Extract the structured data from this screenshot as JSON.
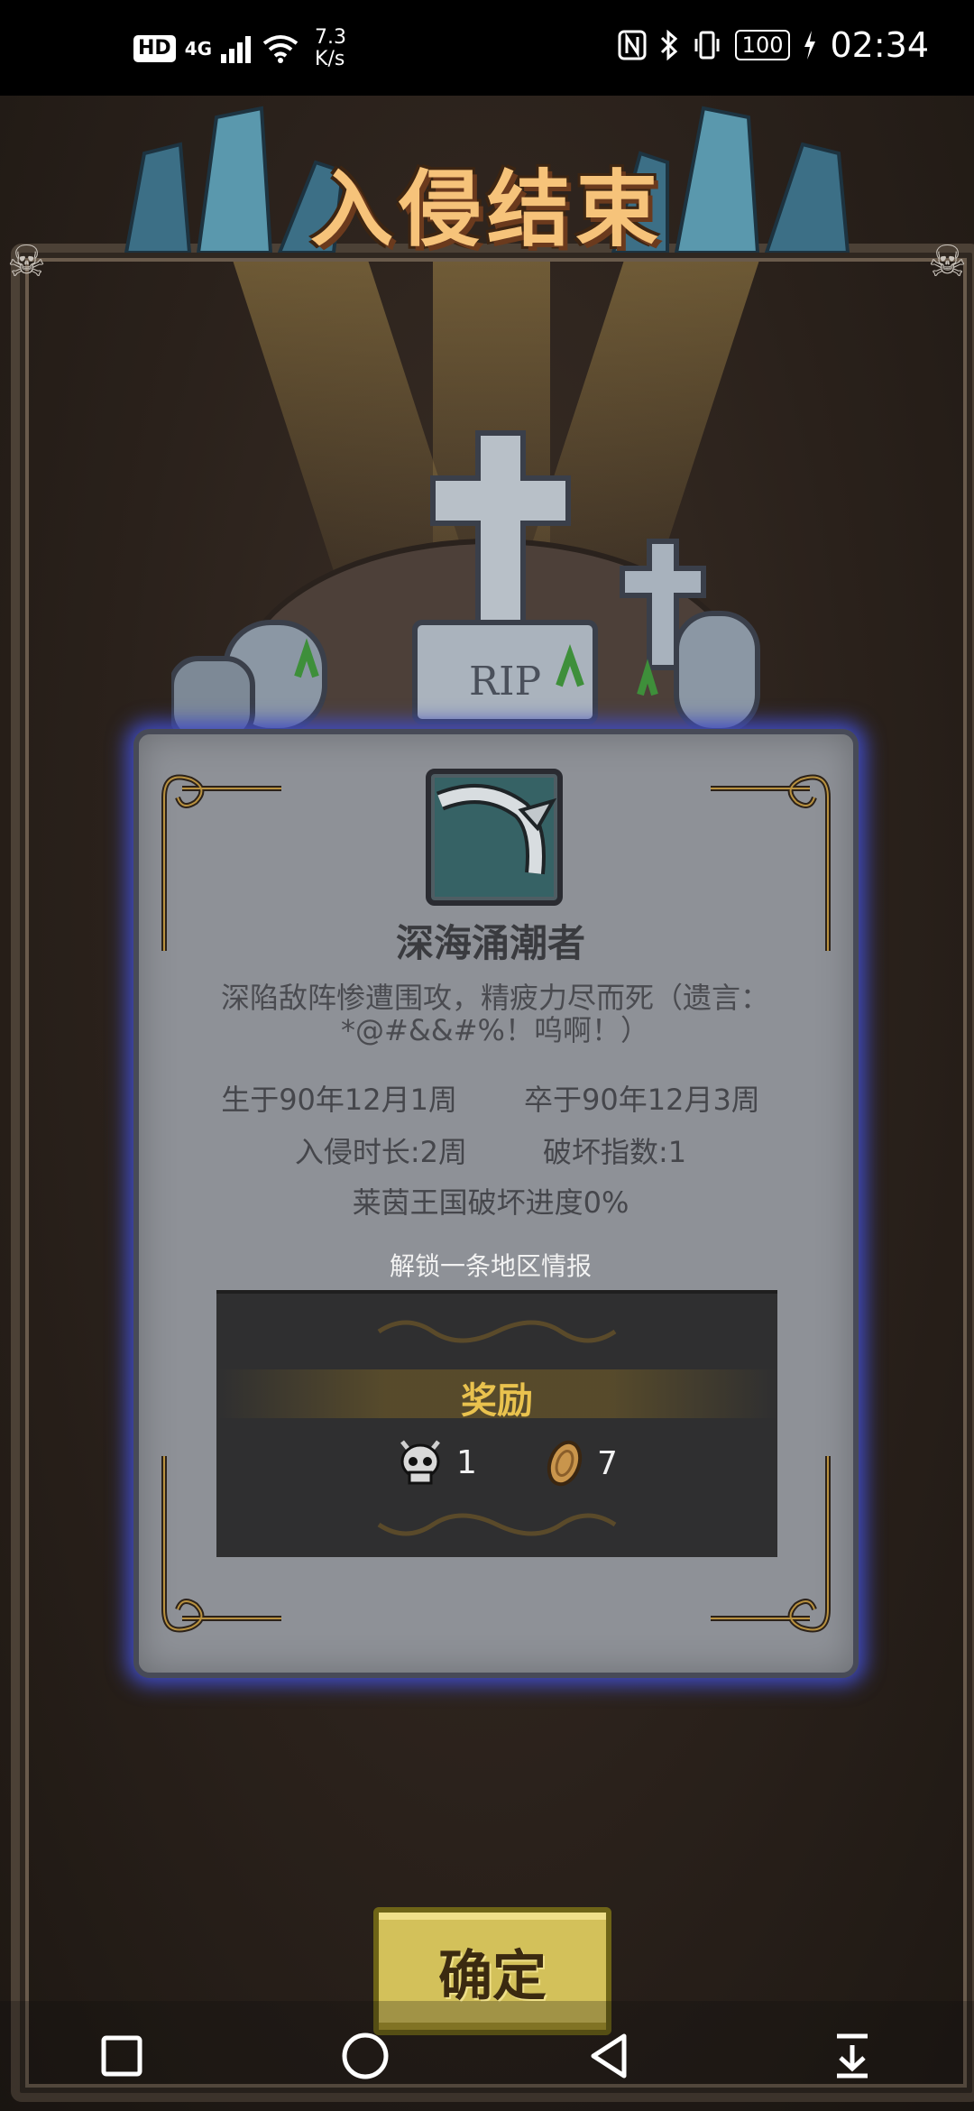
{
  "status_bar": {
    "hd_label": "HD",
    "network_label": "4G",
    "speed_value": "7.3",
    "speed_unit": "K/s",
    "battery_level": "100",
    "time": "02:34"
  },
  "screen": {
    "title": "入侵结束"
  },
  "result_card": {
    "unit_name": "深海涌潮者",
    "death_description": "深陷敌阵惨遭围攻，精疲力尽而死（遗言：*@#&&#%！呜啊！）",
    "born": "生于90年12月1周",
    "died": "卒于90年12月3周",
    "invasion_duration": "入侵时长:2周",
    "destruction_index": "破坏指数:1",
    "kingdom_progress": "莱茵王国破坏进度0%",
    "unlock_text": "解锁一条地区情报"
  },
  "rewards": {
    "title": "奖励",
    "items": [
      {
        "icon": "demon-skull-icon",
        "count": "1"
      },
      {
        "icon": "gold-coin-icon",
        "count": "7"
      }
    ]
  },
  "confirm_button": {
    "label": "确定"
  },
  "colors": {
    "card_glow": "#3f4bc2",
    "title_orange": "#f6c37a",
    "reward_gold": "#e9c24e",
    "button_yellow": "#d3c15a"
  }
}
